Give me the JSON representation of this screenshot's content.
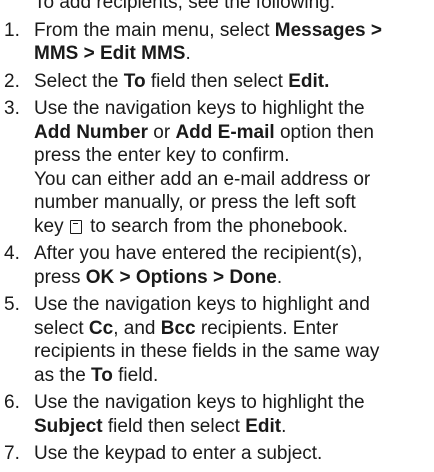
{
  "top_partial_line": "To add recipients, see the following.",
  "steps": [
    {
      "number": "1.",
      "lines": [
        [
          {
            "t": "From the main menu, select "
          },
          {
            "t": "Messages >",
            "b": true
          }
        ],
        [
          {
            "t": "MMS > Edit MMS",
            "b": true
          },
          {
            "t": "."
          }
        ]
      ]
    },
    {
      "number": "2.",
      "lines": [
        [
          {
            "t": "Select the "
          },
          {
            "t": "To",
            "b": true
          },
          {
            "t": " field then select "
          },
          {
            "t": "Edit.",
            "b": true
          }
        ]
      ]
    },
    {
      "number": "3.",
      "lines": [
        [
          {
            "t": "Use the navigation keys to highlight the"
          }
        ],
        [
          {
            "t": "Add Number",
            "b": true
          },
          {
            "t": " or "
          },
          {
            "t": "Add E-mail",
            "b": true
          },
          {
            "t": " option then"
          }
        ],
        [
          {
            "t": "press the enter key to confirm."
          }
        ],
        [
          {
            "t": "You can either add an e-mail address or"
          }
        ],
        [
          {
            "t": "number manually, or press the left soft"
          }
        ],
        [
          {
            "t": "key "
          },
          {
            "icon": "left-soft-key-icon"
          },
          {
            "t": " to search from the phonebook."
          }
        ]
      ]
    },
    {
      "number": "4.",
      "lines": [
        [
          {
            "t": "After you have entered the recipient(s),"
          }
        ],
        [
          {
            "t": "press "
          },
          {
            "t": "OK > Options > Done",
            "b": true
          },
          {
            "t": "."
          }
        ]
      ]
    },
    {
      "number": "5.",
      "lines": [
        [
          {
            "t": "Use the navigation keys to highlight and"
          }
        ],
        [
          {
            "t": "select "
          },
          {
            "t": "Cc",
            "b": true
          },
          {
            "t": ", and "
          },
          {
            "t": "Bcc",
            "b": true
          },
          {
            "t": " recipients. Enter"
          }
        ],
        [
          {
            "t": "recipients in these fields in the same way"
          }
        ],
        [
          {
            "t": "as the "
          },
          {
            "t": "To",
            "b": true
          },
          {
            "t": " field."
          }
        ]
      ]
    },
    {
      "number": "6.",
      "lines": [
        [
          {
            "t": "Use the navigation keys to highlight the"
          }
        ],
        [
          {
            "t": "Subject",
            "b": true
          },
          {
            "t": " field then select "
          },
          {
            "t": "Edit",
            "b": true
          },
          {
            "t": "."
          }
        ]
      ]
    },
    {
      "number": "7.",
      "lines": [
        [
          {
            "t": "Use the keypad to enter a subject."
          }
        ]
      ]
    }
  ]
}
